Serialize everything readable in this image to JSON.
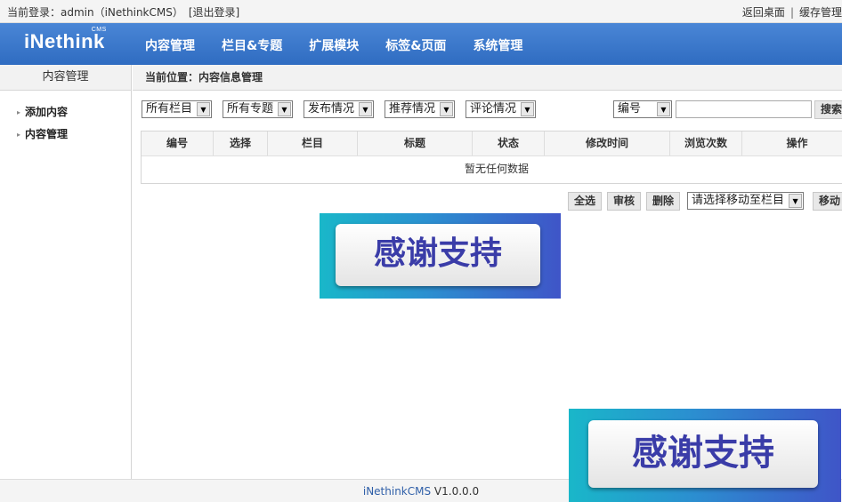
{
  "topbar": {
    "login_label": "当前登录：admin（iNethinkCMS）",
    "logout": "[退出登录]",
    "desktop": "返回桌面",
    "separator": "|",
    "cache": "缓存管理"
  },
  "header": {
    "logo": "iNethink",
    "logo_sup": "CMS",
    "nav": [
      "内容管理",
      "栏目&专题",
      "扩展模块",
      "标签&页面",
      "系统管理"
    ]
  },
  "sidebar": {
    "title": "内容管理",
    "items": [
      "添加内容",
      "内容管理"
    ]
  },
  "main": {
    "breadcrumb": "当前位置：内容信息管理",
    "filters": [
      "所有栏目",
      "所有专题",
      "发布情况",
      "推荐情况",
      "评论情况"
    ],
    "search": {
      "field": "编号",
      "value": "",
      "button": "搜索"
    },
    "table": {
      "headers": [
        "编号",
        "选择",
        "栏目",
        "标题",
        "状态",
        "修改时间",
        "浏览次数",
        "操作"
      ],
      "empty": "暂无任何数据"
    },
    "actions": {
      "select_all": "全选",
      "review": "审核",
      "delete": "删除",
      "move_select": "请选择移动至栏目",
      "move": "移动"
    }
  },
  "banners": {
    "text": "感谢支持"
  },
  "footer": {
    "brand": "iNethinkCMS",
    "version": " V1.0.0.0"
  },
  "colors": {
    "header": "#3a78cc",
    "banner_text": "#3a3ca8"
  }
}
